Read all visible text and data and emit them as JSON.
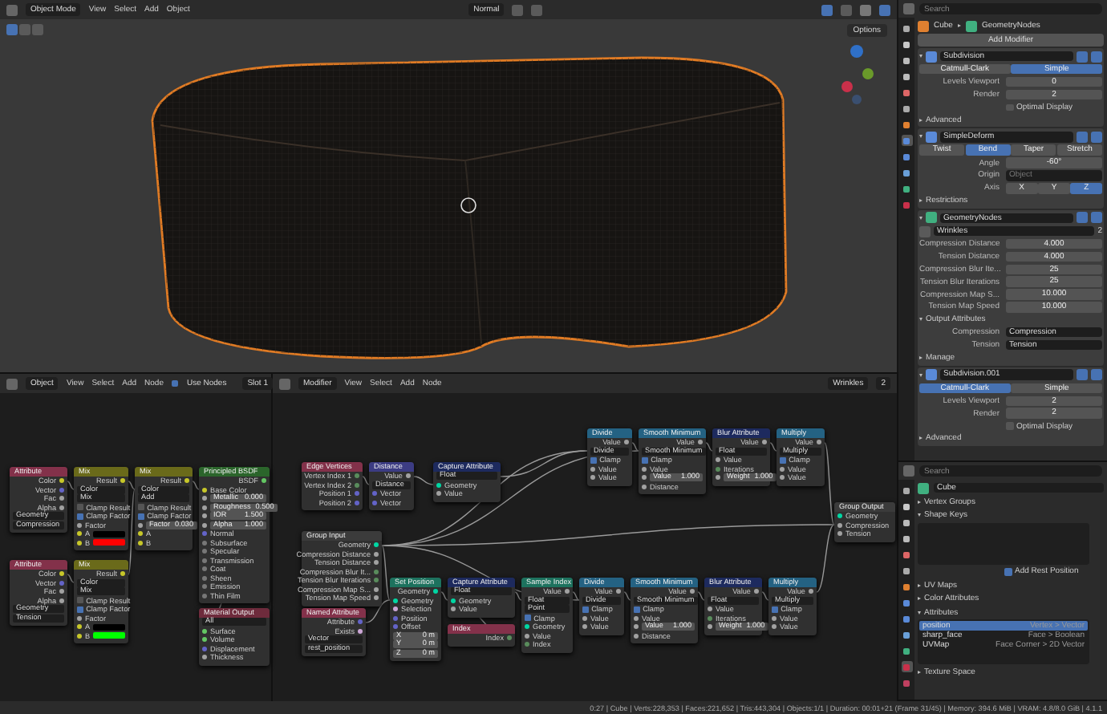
{
  "viewport": {
    "mode": "Object Mode",
    "menus": [
      "View",
      "Select",
      "Add",
      "Object"
    ],
    "orientation": "Normal",
    "options": "Options"
  },
  "shader_editor": {
    "context": "Object",
    "menus": [
      "View",
      "Select",
      "Add",
      "Node"
    ],
    "use_nodes": {
      "label": "Use Nodes",
      "checked": true
    },
    "slot": "Slot 1",
    "nodes": [
      {
        "title": "Attribute",
        "kind": "input",
        "rows": [
          {
            "kind": "out",
            "text": "Color",
            "color": "#c7c729"
          },
          {
            "kind": "out",
            "text": "Vector",
            "color": "#6363c7"
          },
          {
            "kind": "out",
            "text": "Fac",
            "color": "#a1a1a1"
          },
          {
            "kind": "out",
            "text": "Alpha",
            "color": "#a1a1a1"
          },
          {
            "kind": "menu",
            "text": "Geometry"
          },
          {
            "kind": "text",
            "text": "Compression"
          }
        ]
      },
      {
        "title": "Mix",
        "kind": "converter",
        "rows": [
          {
            "kind": "out",
            "text": "Result",
            "color": "#c7c729"
          },
          {
            "kind": "menu",
            "text": "Color"
          },
          {
            "kind": "menu",
            "text": "Mix"
          },
          {
            "kind": "check",
            "text": "Clamp Result",
            "checked": false
          },
          {
            "kind": "check",
            "text": "Clamp Factor",
            "checked": true
          },
          {
            "kind": "in",
            "text": "Factor",
            "color": "#a1a1a1"
          },
          {
            "kind": "swatch",
            "text": "A",
            "color": "#000000"
          },
          {
            "kind": "swatch",
            "text": "B",
            "color": "#ff0000"
          }
        ]
      },
      {
        "title": "Mix",
        "kind": "converter",
        "rows": [
          {
            "kind": "out",
            "text": "Result",
            "color": "#c7c729"
          },
          {
            "kind": "menu",
            "text": "Color"
          },
          {
            "kind": "menu",
            "text": "Add"
          },
          {
            "kind": "check",
            "text": "Clamp Result",
            "checked": false
          },
          {
            "kind": "check",
            "text": "Clamp Factor",
            "checked": true
          },
          {
            "kind": "field",
            "text": "Factor",
            "value": "0.030",
            "color": "#a1a1a1"
          },
          {
            "kind": "in",
            "text": "A",
            "color": "#c7c729"
          },
          {
            "kind": "in",
            "text": "B",
            "color": "#c7c729"
          }
        ]
      },
      {
        "title": "Principled BSDF",
        "kind": "shader",
        "rows": [
          {
            "kind": "out",
            "text": "BSDF",
            "color": "#63c763"
          },
          {
            "kind": "in",
            "text": "Base Color",
            "color": "#c7c729"
          },
          {
            "kind": "field",
            "text": "Metallic",
            "value": "0.000",
            "color": "#a1a1a1"
          },
          {
            "kind": "field",
            "text": "Roughness",
            "value": "0.500",
            "color": "#a1a1a1"
          },
          {
            "kind": "field",
            "text": "IOR",
            "value": "1.500",
            "color": "#a1a1a1"
          },
          {
            "kind": "field",
            "text": "Alpha",
            "value": "1.000",
            "color": "#a1a1a1"
          },
          {
            "kind": "in",
            "text": "Normal",
            "color": "#6363c7"
          },
          {
            "kind": "in",
            "text": "Subsurface",
            "color": "#777777"
          },
          {
            "kind": "in",
            "text": "Specular",
            "color": "#777777"
          },
          {
            "kind": "in",
            "text": "Transmission",
            "color": "#777777"
          },
          {
            "kind": "in",
            "text": "Coat",
            "color": "#777777"
          },
          {
            "kind": "in",
            "text": "Sheen",
            "color": "#777777"
          },
          {
            "kind": "in",
            "text": "Emission",
            "color": "#777777"
          },
          {
            "kind": "in",
            "text": "Thin Film",
            "color": "#777777"
          }
        ]
      },
      {
        "title": "Attribute",
        "kind": "input",
        "rows": [
          {
            "kind": "out",
            "text": "Color",
            "color": "#c7c729"
          },
          {
            "kind": "out",
            "text": "Vector",
            "color": "#6363c7"
          },
          {
            "kind": "out",
            "text": "Fac",
            "color": "#a1a1a1"
          },
          {
            "kind": "out",
            "text": "Alpha",
            "color": "#a1a1a1"
          },
          {
            "kind": "menu",
            "text": "Geometry"
          },
          {
            "kind": "text",
            "text": "Tension"
          }
        ]
      },
      {
        "title": "Mix",
        "kind": "converter",
        "rows": [
          {
            "kind": "out",
            "text": "Result",
            "color": "#c7c729"
          },
          {
            "kind": "menu",
            "text": "Color"
          },
          {
            "kind": "menu",
            "text": "Mix"
          },
          {
            "kind": "check",
            "text": "Clamp Result",
            "checked": false
          },
          {
            "kind": "check",
            "text": "Clamp Factor",
            "checked": true
          },
          {
            "kind": "in",
            "text": "Factor",
            "color": "#a1a1a1"
          },
          {
            "kind": "swatch",
            "text": "A",
            "color": "#000000"
          },
          {
            "kind": "swatch",
            "text": "B",
            "color": "#00ff00"
          }
        ]
      },
      {
        "title": "Material Output",
        "kind": "output",
        "rows": [
          {
            "kind": "menu",
            "text": "All"
          },
          {
            "kind": "in",
            "text": "Surface",
            "color": "#63c763"
          },
          {
            "kind": "in",
            "text": "Volume",
            "color": "#63c763"
          },
          {
            "kind": "in",
            "text": "Displacement",
            "color": "#6363c7"
          },
          {
            "kind": "in",
            "text": "Thickness",
            "color": "#a1a1a1"
          }
        ]
      }
    ]
  },
  "geometry_editor": {
    "context": "Modifier",
    "menus": [
      "View",
      "Select",
      "Add",
      "Node"
    ],
    "group": "Wrinkles",
    "users": "2",
    "nodes": [
      {
        "title": "Edge Vertices",
        "kind": "input",
        "rows": [
          {
            "kind": "out",
            "text": "Vertex Index 1",
            "color": "#598c5c"
          },
          {
            "kind": "out",
            "text": "Vertex Index 2",
            "color": "#598c5c"
          },
          {
            "kind": "out",
            "text": "Position 1",
            "color": "#6363c7"
          },
          {
            "kind": "out",
            "text": "Position 2",
            "color": "#6363c7"
          }
        ]
      },
      {
        "title": "Distance",
        "kind": "vector",
        "rows": [
          {
            "kind": "out",
            "text": "Value",
            "color": "#a1a1a1"
          },
          {
            "kind": "menu",
            "text": "Distance"
          },
          {
            "kind": "in",
            "text": "Vector",
            "color": "#6363c7"
          },
          {
            "kind": "in",
            "text": "Vector",
            "color": "#6363c7"
          }
        ]
      },
      {
        "title": "Capture Attribute",
        "kind": "attribute",
        "rows": [
          {
            "kind": "menu",
            "text": "Float"
          },
          {
            "kind": "in",
            "text": "Geometry",
            "color": "#00d6a3"
          },
          {
            "kind": "in",
            "text": "Value",
            "color": "#a1a1a1"
          }
        ]
      },
      {
        "title": "Group Input",
        "kind": "group",
        "rows": [
          {
            "kind": "out",
            "text": "Geometry",
            "color": "#00d6a3"
          },
          {
            "kind": "out",
            "text": "Compression Distance",
            "color": "#a1a1a1"
          },
          {
            "kind": "out",
            "text": "Tension Distance",
            "color": "#a1a1a1"
          },
          {
            "kind": "out",
            "text": "Compression Blur It...",
            "color": "#598c5c"
          },
          {
            "kind": "out",
            "text": "Tension Blur Iterations",
            "color": "#598c5c"
          },
          {
            "kind": "out",
            "text": "Compression Map S...",
            "color": "#a1a1a1"
          },
          {
            "kind": "out",
            "text": "Tension Map Speed",
            "color": "#a1a1a1"
          }
        ]
      },
      {
        "title": "Named Attribute",
        "kind": "input",
        "rows": [
          {
            "kind": "out",
            "text": "Attribute",
            "color": "#6363c7"
          },
          {
            "kind": "out",
            "text": "Exists",
            "color": "#cca6d6"
          },
          {
            "kind": "menu",
            "text": "Vector"
          },
          {
            "kind": "text",
            "text": "rest_position"
          }
        ]
      },
      {
        "title": "Set Position",
        "kind": "geometry",
        "rows": [
          {
            "kind": "out",
            "text": "Geometry",
            "color": "#00d6a3"
          },
          {
            "kind": "in",
            "text": "Geometry",
            "color": "#00d6a3"
          },
          {
            "kind": "in",
            "text": "Selection",
            "color": "#cca6d6"
          },
          {
            "kind": "in",
            "text": "Position",
            "color": "#6363c7"
          },
          {
            "kind": "in",
            "text": "Offset",
            "color": "#6363c7"
          },
          {
            "kind": "field",
            "text": "X",
            "value": "0 m"
          },
          {
            "kind": "field",
            "text": "Y",
            "value": "0 m"
          },
          {
            "kind": "field",
            "text": "Z",
            "value": "0 m"
          }
        ]
      },
      {
        "title": "Capture Attribute",
        "kind": "attribute",
        "rows": [
          {
            "kind": "menu",
            "text": "Float"
          },
          {
            "kind": "in",
            "text": "Geometry",
            "color": "#00d6a3"
          },
          {
            "kind": "in",
            "text": "Value",
            "color": "#a1a1a1"
          }
        ]
      },
      {
        "title": "Index",
        "kind": "input",
        "rows": [
          {
            "kind": "out",
            "text": "Index",
            "color": "#598c5c"
          }
        ]
      },
      {
        "title": "Sample Index",
        "kind": "geometry",
        "rows": [
          {
            "kind": "out",
            "text": "Value",
            "color": "#a1a1a1"
          },
          {
            "kind": "menu",
            "text": "Float"
          },
          {
            "kind": "menu",
            "text": "Point"
          },
          {
            "kind": "check",
            "text": "Clamp",
            "checked": true
          },
          {
            "kind": "in",
            "text": "Geometry",
            "color": "#00d6a3"
          },
          {
            "kind": "in",
            "text": "Value",
            "color": "#a1a1a1"
          },
          {
            "kind": "in",
            "text": "Index",
            "color": "#598c5c"
          }
        ]
      },
      {
        "title": "Divide",
        "kind": "math",
        "rows": [
          {
            "kind": "out",
            "text": "Value",
            "color": "#a1a1a1"
          },
          {
            "kind": "menu",
            "text": "Divide"
          },
          {
            "kind": "check",
            "text": "Clamp",
            "checked": true
          },
          {
            "kind": "in",
            "text": "Value",
            "color": "#a1a1a1"
          },
          {
            "kind": "in",
            "text": "Value",
            "color": "#a1a1a1"
          }
        ]
      },
      {
        "title": "Smooth Minimum",
        "kind": "math",
        "rows": [
          {
            "kind": "out",
            "text": "Value",
            "color": "#a1a1a1"
          },
          {
            "kind": "menu",
            "text": "Smooth Minimum"
          },
          {
            "kind": "check",
            "text": "Clamp",
            "checked": true
          },
          {
            "kind": "in",
            "text": "Value",
            "color": "#a1a1a1"
          },
          {
            "kind": "field",
            "text": "Value",
            "value": "1.000",
            "color": "#a1a1a1"
          },
          {
            "kind": "in",
            "text": "Distance",
            "color": "#a1a1a1"
          }
        ]
      },
      {
        "title": "Blur Attribute",
        "kind": "attribute",
        "rows": [
          {
            "kind": "out",
            "text": "Value",
            "color": "#a1a1a1"
          },
          {
            "kind": "menu",
            "text": "Float"
          },
          {
            "kind": "in",
            "text": "Value",
            "color": "#a1a1a1"
          },
          {
            "kind": "in",
            "text": "Iterations",
            "color": "#598c5c"
          },
          {
            "kind": "field",
            "text": "Weight",
            "value": "1.000",
            "color": "#a1a1a1"
          }
        ]
      },
      {
        "title": "Multiply",
        "kind": "math",
        "rows": [
          {
            "kind": "out",
            "text": "Value",
            "color": "#a1a1a1"
          },
          {
            "kind": "menu",
            "text": "Multiply"
          },
          {
            "kind": "check",
            "text": "Clamp",
            "checked": true
          },
          {
            "kind": "in",
            "text": "Value",
            "color": "#a1a1a1"
          },
          {
            "kind": "in",
            "text": "Value",
            "color": "#a1a1a1"
          }
        ]
      },
      {
        "title": "Divide",
        "kind": "math",
        "rows": [
          {
            "kind": "out",
            "text": "Value",
            "color": "#a1a1a1"
          },
          {
            "kind": "menu",
            "text": "Divide"
          },
          {
            "kind": "check",
            "text": "Clamp",
            "checked": true
          },
          {
            "kind": "in",
            "text": "Value",
            "color": "#a1a1a1"
          },
          {
            "kind": "in",
            "text": "Value",
            "color": "#a1a1a1"
          }
        ]
      },
      {
        "title": "Smooth Minimum",
        "kind": "math",
        "rows": [
          {
            "kind": "out",
            "text": "Value",
            "color": "#a1a1a1"
          },
          {
            "kind": "menu",
            "text": "Smooth Minimum"
          },
          {
            "kind": "check",
            "text": "Clamp",
            "checked": true
          },
          {
            "kind": "in",
            "text": "Value",
            "color": "#a1a1a1"
          },
          {
            "kind": "field",
            "text": "Value",
            "value": "1.000",
            "color": "#a1a1a1"
          },
          {
            "kind": "in",
            "text": "Distance",
            "color": "#a1a1a1"
          }
        ]
      },
      {
        "title": "Blur Attribute",
        "kind": "attribute",
        "rows": [
          {
            "kind": "out",
            "text": "Value",
            "color": "#a1a1a1"
          },
          {
            "kind": "menu",
            "text": "Float"
          },
          {
            "kind": "in",
            "text": "Value",
            "color": "#a1a1a1"
          },
          {
            "kind": "in",
            "text": "Iterations",
            "color": "#598c5c"
          },
          {
            "kind": "field",
            "text": "Weight",
            "value": "1.000",
            "color": "#a1a1a1"
          }
        ]
      },
      {
        "title": "Multiply",
        "kind": "math",
        "rows": [
          {
            "kind": "out",
            "text": "Value",
            "color": "#a1a1a1"
          },
          {
            "kind": "menu",
            "text": "Multiply"
          },
          {
            "kind": "check",
            "text": "Clamp",
            "checked": true
          },
          {
            "kind": "in",
            "text": "Value",
            "color": "#a1a1a1"
          },
          {
            "kind": "in",
            "text": "Value",
            "color": "#a1a1a1"
          }
        ]
      },
      {
        "title": "Group Output",
        "kind": "group",
        "rows": [
          {
            "kind": "in",
            "text": "Geometry",
            "color": "#00d6a3"
          },
          {
            "kind": "in",
            "text": "Compression",
            "color": "#a1a1a1"
          },
          {
            "kind": "in",
            "text": "Tension",
            "color": "#a1a1a1"
          }
        ]
      }
    ]
  },
  "properties": {
    "search": {
      "placeholder": "Search"
    },
    "object": "Cube",
    "modifier_tab": "GeometryNodes",
    "tab_strip": [
      {
        "selected": false
      },
      {
        "selected": false
      },
      {
        "selected": false
      },
      {
        "selected": false
      },
      {
        "selected": false
      },
      {
        "selected": false
      },
      {
        "selected": false
      },
      {
        "selected": true
      },
      {
        "selected": false
      },
      {
        "selected": false
      },
      {
        "selected": false
      },
      {
        "selected": false
      }
    ],
    "add_button": "Add Modifier",
    "modifiers": [
      {
        "name": "Subdivision",
        "kind": "subdivision",
        "rows": [
          {
            "kind": "tabs",
            "options": [
              {
                "label": "Catmull-Clark",
                "selected": false
              },
              {
                "label": "Simple",
                "selected": true
              }
            ]
          },
          {
            "kind": "number",
            "label": "Levels Viewport",
            "value": "0"
          },
          {
            "kind": "number",
            "label": "Render",
            "value": "2"
          },
          {
            "kind": "check",
            "label": "Optimal Display",
            "checked": false
          },
          {
            "kind": "section",
            "label": "Advanced",
            "expanded": false
          }
        ]
      },
      {
        "name": "SimpleDeform",
        "kind": "deform",
        "rows": [
          {
            "kind": "tabs",
            "options": [
              {
                "label": "Twist",
                "selected": false
              },
              {
                "label": "Bend",
                "selected": true
              },
              {
                "label": "Taper",
                "selected": false
              },
              {
                "label": "Stretch",
                "selected": false
              }
            ]
          },
          {
            "kind": "number",
            "label": "Angle",
            "value": "-60°"
          },
          {
            "kind": "object",
            "label": "Origin",
            "placeholder": "Object"
          },
          {
            "kind": "axis",
            "label": "Axis",
            "options": [
              {
                "label": "X",
                "selected": false
              },
              {
                "label": "Y",
                "selected": false
              },
              {
                "label": "Z",
                "selected": true
              }
            ]
          },
          {
            "kind": "section",
            "label": "Restrictions",
            "expanded": false
          }
        ]
      },
      {
        "name": "GeometryNodes",
        "kind": "nodes",
        "rows": [
          {
            "kind": "group",
            "value": "Wrinkles",
            "users": "2"
          },
          {
            "kind": "number",
            "label": "Compression Distance",
            "value": "4.000"
          },
          {
            "kind": "number",
            "label": "Tension Distance",
            "value": "4.000"
          },
          {
            "kind": "number",
            "label": "Compression Blur Ite...",
            "value": "25"
          },
          {
            "kind": "number",
            "label": "Tension Blur Iterations",
            "value": "25"
          },
          {
            "kind": "number",
            "label": "Compression Map S...",
            "value": "10.000"
          },
          {
            "kind": "number",
            "label": "Tension Map Speed",
            "value": "10.000"
          },
          {
            "kind": "section",
            "label": "Output Attributes",
            "expanded": true
          },
          {
            "kind": "text",
            "label": "Compression",
            "value": "Compression"
          },
          {
            "kind": "text",
            "label": "Tension",
            "value": "Tension"
          },
          {
            "kind": "section",
            "label": "Manage",
            "expanded": false
          }
        ]
      },
      {
        "name": "Subdivision.001",
        "kind": "subdivision",
        "rows": [
          {
            "kind": "tabs",
            "options": [
              {
                "label": "Catmull-Clark",
                "selected": true
              },
              {
                "label": "Simple",
                "selected": false
              }
            ]
          },
          {
            "kind": "number",
            "label": "Levels Viewport",
            "value": "2"
          },
          {
            "kind": "number",
            "label": "Render",
            "value": "2"
          },
          {
            "kind": "check",
            "label": "Optimal Display",
            "checked": false
          },
          {
            "kind": "section",
            "label": "Advanced",
            "expanded": false
          }
        ]
      }
    ]
  },
  "data_properties": {
    "search": {
      "placeholder": "Search"
    },
    "mesh": "Cube",
    "tab_strip": [
      {
        "selected": false
      },
      {
        "selected": false
      },
      {
        "selected": false
      },
      {
        "selected": false
      },
      {
        "selected": false
      },
      {
        "selected": false
      },
      {
        "selected": false
      },
      {
        "selected": false
      },
      {
        "selected": false
      },
      {
        "selected": false
      },
      {
        "selected": false
      },
      {
        "selected": true
      },
      {
        "selected": false
      }
    ],
    "rows": [
      {
        "kind": "section",
        "label": "Vertex Groups",
        "expanded": false
      },
      {
        "kind": "section",
        "label": "Shape Keys",
        "expanded": true
      },
      {
        "kind": "list",
        "items": []
      },
      {
        "kind": "check",
        "label": "Add Rest Position",
        "checked": true
      },
      {
        "kind": "section",
        "label": "UV Maps",
        "expanded": false
      },
      {
        "kind": "section",
        "label": "Color Attributes",
        "expanded": false
      },
      {
        "kind": "section",
        "label": "Attributes",
        "expanded": true
      },
      {
        "kind": "list",
        "items": [
          {
            "name": "position",
            "detail": "Vertex > Vector",
            "selected": true
          },
          {
            "name": "sharp_face",
            "detail": "Face > Boolean",
            "selected": false
          },
          {
            "name": "UVMap",
            "detail": "Face Corner > 2D Vector",
            "selected": false
          }
        ]
      },
      {
        "kind": "section",
        "label": "Texture Space",
        "expanded": false
      }
    ]
  },
  "status_bar": "0:27 | Cube | Verts:228,353 | Faces:221,652 | Tris:443,304 | Objects:1/1 | Duration: 00:01+21 (Frame 31/45) | Memory: 394.6 MiB | VRAM: 4.8/8.0 GiB | 4.1.1"
}
